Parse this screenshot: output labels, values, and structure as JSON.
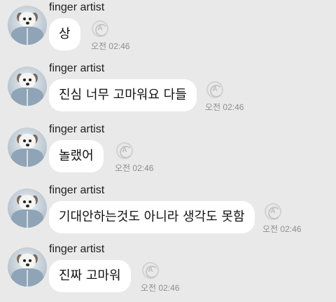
{
  "messages": [
    {
      "sender": "finger artist",
      "text": "상",
      "time": "오전 02:46",
      "read_mark": "A"
    },
    {
      "sender": "finger artist",
      "text": "진심 너무 고마워요 다들",
      "time": "오전 02:46",
      "read_mark": "A"
    },
    {
      "sender": "finger artist",
      "text": "놀랬어",
      "time": "오전 02:46",
      "read_mark": "A"
    },
    {
      "sender": "finger artist",
      "text": "기대안하는것도 아니라 생각도 못함",
      "time": "오전 02:46",
      "read_mark": "A"
    },
    {
      "sender": "finger artist",
      "text": "진짜 고마워",
      "time": "오전 02:46",
      "read_mark": "A"
    }
  ],
  "colors": {
    "background": "#e9e9e9",
    "bubble": "#ffffff",
    "text": "#111111",
    "time": "#8e8e8e",
    "read_icon": "#c6c6c6"
  },
  "icons": {
    "avatar": "dog-profile-photo",
    "read_status": "refresh-read-icon"
  }
}
